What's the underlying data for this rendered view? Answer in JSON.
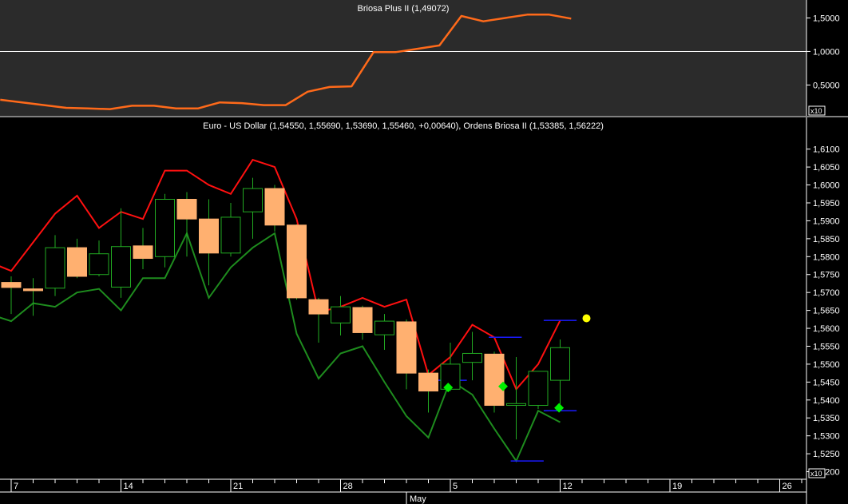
{
  "chart_data": [
    {
      "type": "line",
      "title": "Briosa Plus II (1,49072)",
      "scale_badge": "x10",
      "ylim": [
        0.1,
        1.72
      ],
      "yticks": [
        "1,5000",
        "1,0000",
        "0,5000"
      ],
      "ytick_values": [
        1.5,
        1.0,
        0.5
      ],
      "reference_line": 1.0,
      "colors": {
        "line": "#ff6a1a",
        "panel": "#2b2b2b",
        "reference": "#ffffff"
      },
      "series": [
        {
          "x": [
            -1,
            1,
            3,
            5,
            7,
            9,
            11,
            13,
            15,
            17,
            19,
            21,
            23,
            25,
            27,
            29,
            31,
            33,
            35,
            37,
            39,
            41,
            43,
            45,
            47,
            49,
            51
          ],
          "values": [
            0.28,
            0.24,
            0.2,
            0.16,
            0.15,
            0.14,
            0.19,
            0.19,
            0.15,
            0.15,
            0.24,
            0.23,
            0.2,
            0.2,
            0.4,
            0.47,
            0.48,
            0.99,
            0.99,
            1.04,
            1.09,
            1.53,
            1.45,
            1.5,
            1.55,
            1.55,
            1.49
          ]
        }
      ]
    },
    {
      "type": "candlestick",
      "title": "Euro - US Dollar (1,54550, 1,55690, 1,53690, 1,55460, +0,00640), Ordens Briosa II (1,53385, 1,56222)",
      "scale_badge": "x10",
      "ylim": [
        1.517,
        1.6155
      ],
      "yticks": [
        "1,6100",
        "1,6050",
        "1,6000",
        "1,5950",
        "1,5900",
        "1,5850",
        "1,5800",
        "1,5750",
        "1,5700",
        "1,5650",
        "1,5600",
        "1,5550",
        "1,5500",
        "1,5450",
        "1,5400",
        "1,5350",
        "1,5300",
        "1,5250",
        "1,5200"
      ],
      "ytick_values": [
        1.61,
        1.605,
        1.6,
        1.595,
        1.59,
        1.585,
        1.58,
        1.575,
        1.57,
        1.565,
        1.56,
        1.555,
        1.55,
        1.545,
        1.54,
        1.535,
        1.53,
        1.525,
        1.52
      ],
      "xaxis": {
        "ticks": [
          {
            "day": 0,
            "label": "7"
          },
          {
            "day": 10,
            "label": "14"
          },
          {
            "day": 20,
            "label": "21"
          },
          {
            "day": 30,
            "label": "28"
          },
          {
            "day": 40,
            "label": "5"
          },
          {
            "day": 50,
            "label": "12"
          },
          {
            "day": 60,
            "label": "19"
          },
          {
            "day": 70,
            "label": "26"
          }
        ],
        "minor_step": 2,
        "month_label": "May",
        "month_day": 36
      },
      "colors": {
        "bear_fill": "#ffb070",
        "bull_outline": "#22aa22",
        "wick": "#22aa22",
        "upper_band": "#ff1010",
        "lower_band": "#1e8c1e",
        "order_line": "#1a1aff",
        "marker": "#00ee00",
        "dot": "#ffff00"
      },
      "candles": [
        {
          "day": 0,
          "open": 1.5728,
          "high": 1.5745,
          "low": 1.564,
          "close": 1.5714
        },
        {
          "day": 2,
          "open": 1.571,
          "high": 1.574,
          "low": 1.5635,
          "close": 1.5705
        },
        {
          "day": 4,
          "open": 1.5712,
          "high": 1.586,
          "low": 1.569,
          "close": 1.5825
        },
        {
          "day": 6,
          "open": 1.5825,
          "high": 1.585,
          "low": 1.574,
          "close": 1.5745
        },
        {
          "day": 8,
          "open": 1.575,
          "high": 1.5845,
          "low": 1.5745,
          "close": 1.5808
        },
        {
          "day": 10,
          "open": 1.5715,
          "high": 1.5935,
          "low": 1.5685,
          "close": 1.5828
        },
        {
          "day": 12,
          "open": 1.583,
          "high": 1.588,
          "low": 1.5765,
          "close": 1.5795
        },
        {
          "day": 14,
          "open": 1.58,
          "high": 1.5975,
          "low": 1.577,
          "close": 1.596
        },
        {
          "day": 16,
          "open": 1.596,
          "high": 1.598,
          "low": 1.58,
          "close": 1.5905
        },
        {
          "day": 18,
          "open": 1.5905,
          "high": 1.596,
          "low": 1.572,
          "close": 1.581
        },
        {
          "day": 20,
          "open": 1.581,
          "high": 1.595,
          "low": 1.58,
          "close": 1.591
        },
        {
          "day": 22,
          "open": 1.5925,
          "high": 1.602,
          "low": 1.585,
          "close": 1.599
        },
        {
          "day": 24,
          "open": 1.599,
          "high": 1.6,
          "low": 1.587,
          "close": 1.5888
        },
        {
          "day": 26,
          "open": 1.5888,
          "high": 1.589,
          "low": 1.568,
          "close": 1.5685
        },
        {
          "day": 28,
          "open": 1.568,
          "high": 1.5685,
          "low": 1.556,
          "close": 1.564
        },
        {
          "day": 30,
          "open": 1.5615,
          "high": 1.569,
          "low": 1.558,
          "close": 1.566
        },
        {
          "day": 32,
          "open": 1.5658,
          "high": 1.5663,
          "low": 1.5568,
          "close": 1.5588
        },
        {
          "day": 34,
          "open": 1.5582,
          "high": 1.564,
          "low": 1.554,
          "close": 1.562
        },
        {
          "day": 36,
          "open": 1.5618,
          "high": 1.5625,
          "low": 1.543,
          "close": 1.5475
        },
        {
          "day": 38,
          "open": 1.5475,
          "high": 1.5485,
          "low": 1.5365,
          "close": 1.5425
        },
        {
          "day": 40,
          "open": 1.543,
          "high": 1.556,
          "low": 1.5425,
          "close": 1.55
        },
        {
          "day": 42,
          "open": 1.5505,
          "high": 1.559,
          "low": 1.5455,
          "close": 1.553
        },
        {
          "day": 44,
          "open": 1.5528,
          "high": 1.5535,
          "low": 1.5365,
          "close": 1.5385
        },
        {
          "day": 46,
          "open": 1.5385,
          "high": 1.552,
          "low": 1.529,
          "close": 1.539
        },
        {
          "day": 48,
          "open": 1.5385,
          "high": 1.548,
          "low": 1.5375,
          "close": 1.548
        },
        {
          "day": 50,
          "open": 1.5455,
          "high": 1.5569,
          "low": 1.5369,
          "close": 1.5546
        }
      ],
      "upper_band": [
        [
          -2,
          1.5785
        ],
        [
          0,
          1.576
        ],
        [
          2,
          1.584
        ],
        [
          4,
          1.592
        ],
        [
          6,
          1.597
        ],
        [
          8,
          1.588
        ],
        [
          10,
          1.5925
        ],
        [
          12,
          1.5905
        ],
        [
          14,
          1.604
        ],
        [
          16,
          1.604
        ],
        [
          18,
          1.6
        ],
        [
          20,
          1.5975
        ],
        [
          22,
          1.607
        ],
        [
          24,
          1.605
        ],
        [
          26,
          1.5905
        ],
        [
          28,
          1.5645
        ],
        [
          30,
          1.566
        ],
        [
          32,
          1.5685
        ],
        [
          34,
          1.566
        ],
        [
          36,
          1.568
        ],
        [
          38,
          1.547
        ],
        [
          40,
          1.552
        ],
        [
          42,
          1.561
        ],
        [
          44,
          1.5575
        ],
        [
          46,
          1.543
        ],
        [
          48,
          1.55
        ],
        [
          50,
          1.5622
        ]
      ],
      "lower_band": [
        [
          -2,
          1.564
        ],
        [
          0,
          1.562
        ],
        [
          2,
          1.567
        ],
        [
          4,
          1.566
        ],
        [
          6,
          1.57
        ],
        [
          8,
          1.571
        ],
        [
          10,
          1.565
        ],
        [
          12,
          1.574
        ],
        [
          14,
          1.574
        ],
        [
          16,
          1.5865
        ],
        [
          18,
          1.5685
        ],
        [
          20,
          1.577
        ],
        [
          22,
          1.5825
        ],
        [
          24,
          1.5865
        ],
        [
          26,
          1.5585
        ],
        [
          28,
          1.546
        ],
        [
          30,
          1.553
        ],
        [
          32,
          1.555
        ],
        [
          34,
          1.545
        ],
        [
          36,
          1.5355
        ],
        [
          38,
          1.5295
        ],
        [
          40,
          1.5455
        ],
        [
          42,
          1.5415
        ],
        [
          44,
          1.532
        ],
        [
          46,
          1.523
        ],
        [
          48,
          1.537
        ],
        [
          50,
          1.5338
        ]
      ],
      "order_lines": [
        {
          "from": 38.5,
          "to": 41.5,
          "value": 1.5455
        },
        {
          "from": 43.5,
          "to": 46.5,
          "value": 1.5575
        },
        {
          "from": 45.5,
          "to": 48.5,
          "value": 1.523
        },
        {
          "from": 48.5,
          "to": 51.5,
          "value": 1.5622
        },
        {
          "from": 48.5,
          "to": 51.5,
          "value": 1.537
        }
      ],
      "entry_markers": [
        {
          "day": 39.8,
          "value": 1.5435
        },
        {
          "day": 44.8,
          "value": 1.5438
        },
        {
          "day": 49.9,
          "value": 1.5378
        }
      ],
      "current_dot": {
        "day": 52.4,
        "value": 1.5628
      }
    }
  ]
}
